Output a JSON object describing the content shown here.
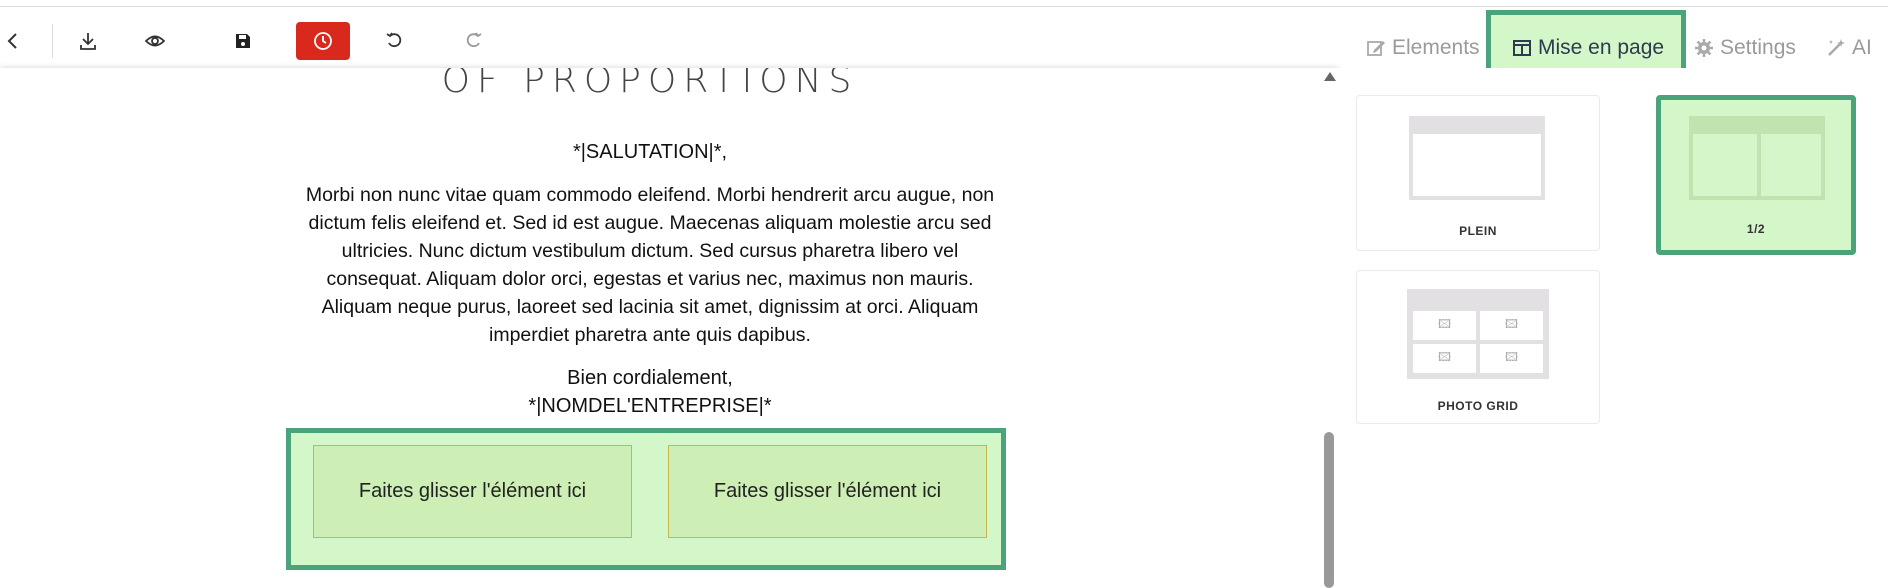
{
  "toolbar": {
    "buttons": [
      "back",
      "download",
      "preview",
      "save",
      "history",
      "undo",
      "redo"
    ]
  },
  "tabs": {
    "elements": "Elements",
    "layout": "Mise en page",
    "settings": "Settings",
    "ai": "AI"
  },
  "email": {
    "heading": "OF PROPORTIONS",
    "salutation": "*|SALUTATION|*,",
    "body": "Morbi non nunc vitae quam commodo eleifend. Morbi hendrerit arcu augue, non dictum felis eleifend et. Sed id est augue. Maecenas aliquam molestie arcu sed ultricies. Nunc dictum vestibulum dictum. Sed cursus pharetra libero vel consequat. Aliquam dolor orci, egestas et varius nec, maximus non mauris. Aliquam neque purus, laoreet sed lacinia sit amet, dignissim at orci. Aliquam imperdiet pharetra ante quis dapibus.",
    "closing_line1": "Bien cordialement,",
    "closing_line2": "*|NOMDEL'ENTREPRISE|*",
    "drop_left": "Faites glisser l'élément ici",
    "drop_right": "Faites glisser l'élément ici"
  },
  "layouts": {
    "full": "PLEIN",
    "half": "1/2",
    "photo_grid": "PHOTO GRID"
  },
  "colors": {
    "highlight_fill": "#d4f7c9",
    "highlight_border": "#4aa37a",
    "history_button": "#d9291c",
    "tab_underline": "#2f6fb3"
  }
}
